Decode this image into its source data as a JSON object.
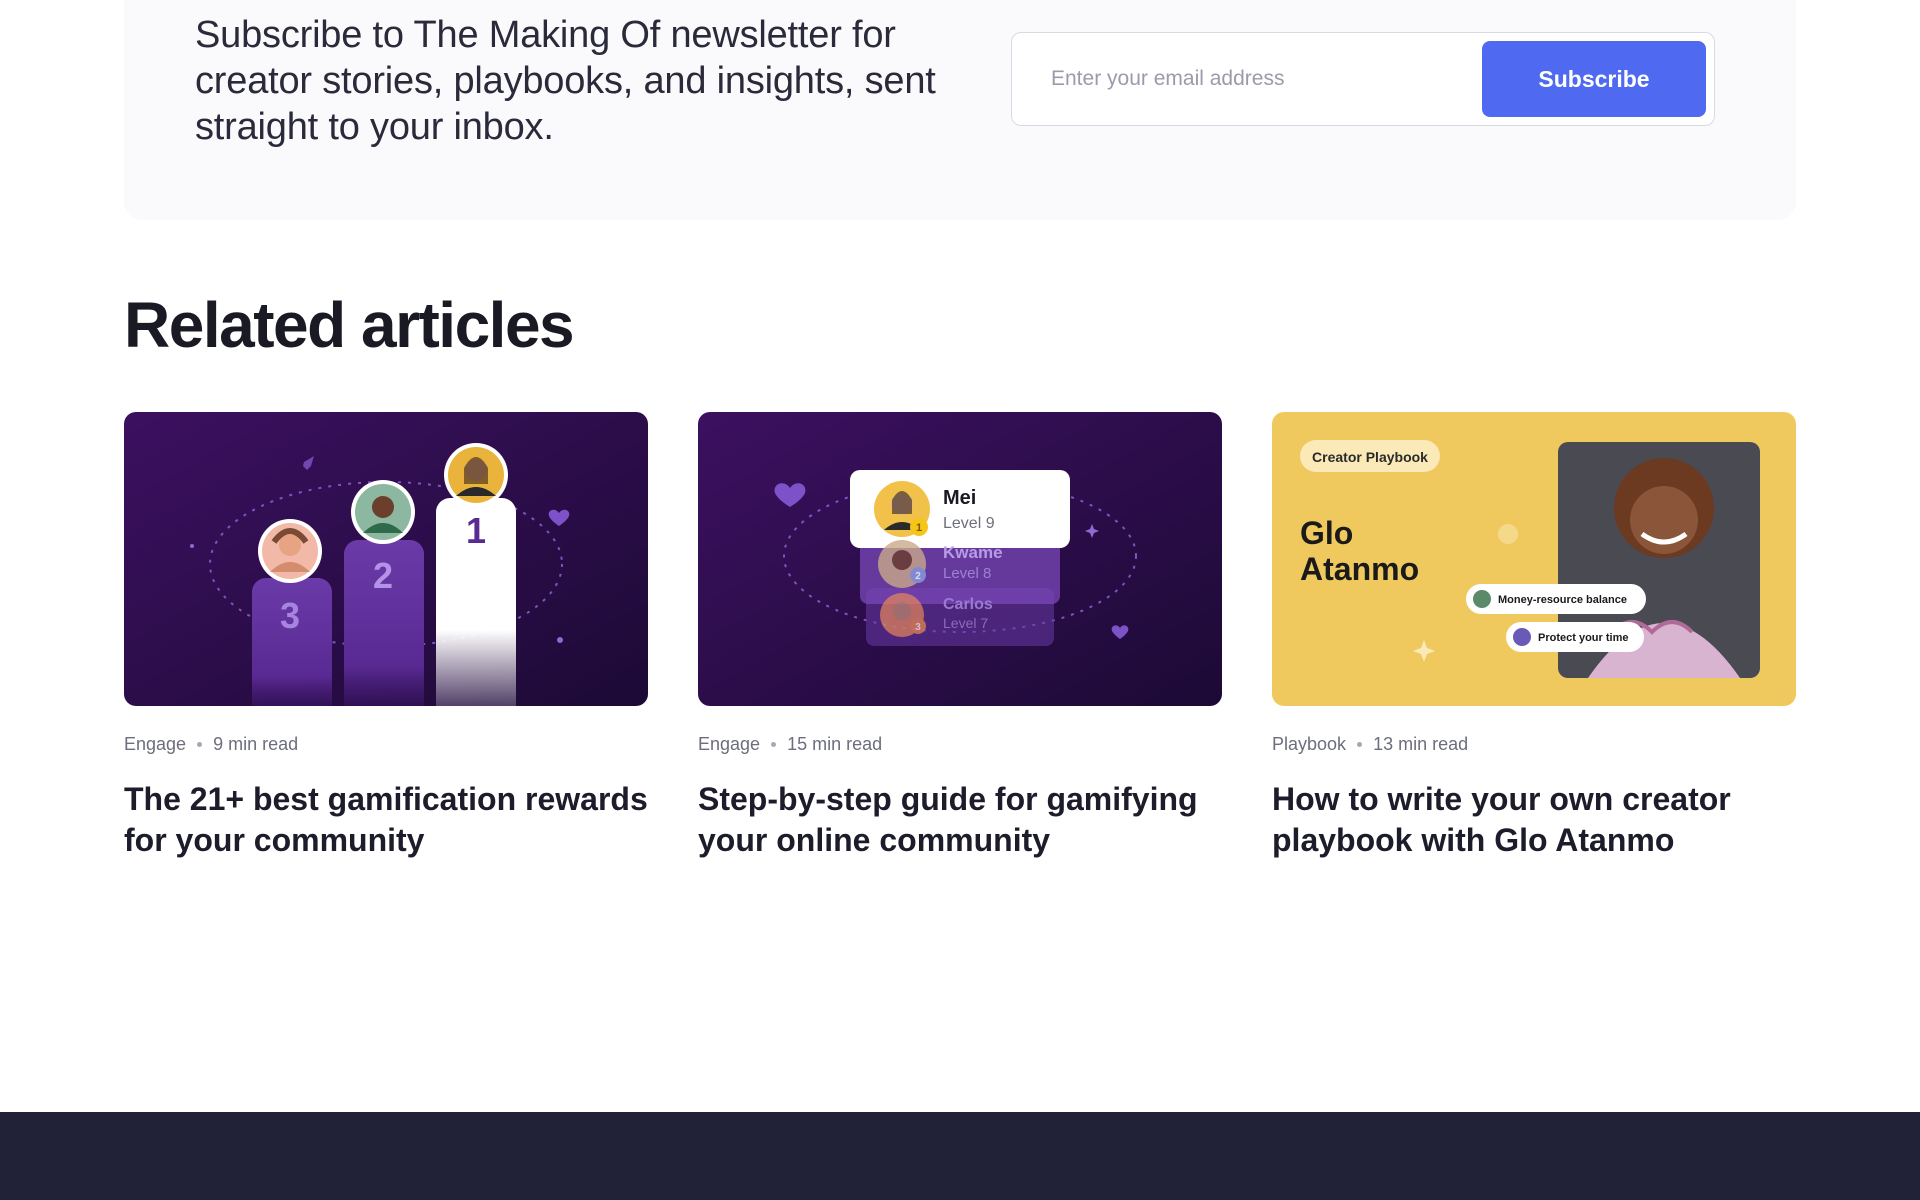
{
  "newsletter": {
    "text": "Subscribe to The Making Of newsletter for creator stories, playbooks, and insights, sent straight to your inbox.",
    "email_placeholder": "Enter your email address",
    "subscribe_label": "Subscribe"
  },
  "related": {
    "title": "Related articles",
    "cards": [
      {
        "category": "Engage",
        "read_time": "9 min read",
        "title": "The 21+ best gamification rewards for your community",
        "podium": [
          "3",
          "2",
          "1"
        ]
      },
      {
        "category": "Engage",
        "read_time": "15 min read",
        "title": "Step-by-step guide for gamifying your online community",
        "leaders": [
          {
            "name": "Mei",
            "level": "Level 9",
            "rank": "1"
          },
          {
            "name": "Kwame",
            "level": "Level 8",
            "rank": "2"
          },
          {
            "name": "Carlos",
            "level": "Level 7",
            "rank": "3"
          }
        ]
      },
      {
        "category": "Playbook",
        "read_time": "13 min read",
        "title": "How to write your own creator playbook with Glo Atanmo",
        "badge": "Creator Playbook",
        "name_line1": "Glo",
        "name_line2": "Atanmo",
        "chip1": "Money-resource balance",
        "chip2": "Protect your time"
      }
    ]
  },
  "colors": {
    "accent": "#4f6af0",
    "purple_dark": "#2a0d45",
    "yellow": "#f0c95e",
    "footer": "#212238"
  }
}
